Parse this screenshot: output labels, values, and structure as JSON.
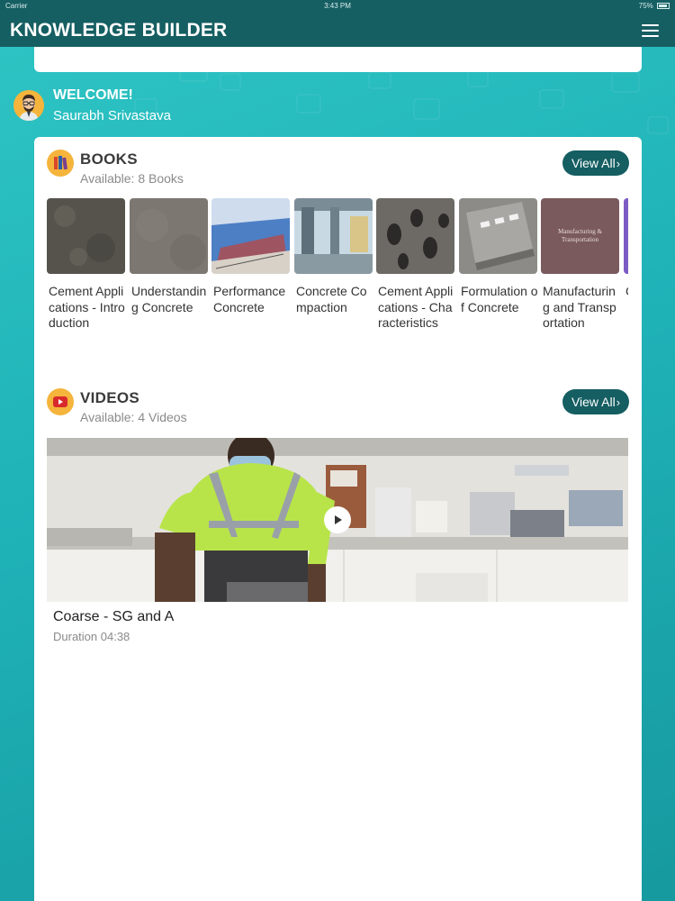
{
  "status_bar": {
    "carrier": "Carrier",
    "time": "3:43 PM",
    "battery": "75%"
  },
  "header": {
    "title": "KNOWLEDGE BUILDER",
    "menu_icon": "hamburger-menu-icon"
  },
  "welcome": {
    "title": "WELCOME!",
    "name": "Saurabh Srivastava"
  },
  "books": {
    "title": "BOOKS",
    "subtitle": "Available: 8 Books",
    "view_all": "View All",
    "items": [
      {
        "title": "Cement Applications - Introduction",
        "cover_color": "#5d5a52"
      },
      {
        "title": "Understanding Concrete",
        "cover_color": "#7c7771"
      },
      {
        "title": "Performance Concrete",
        "cover_color": "#9bb3d4"
      },
      {
        "title": "Concrete Compaction",
        "cover_color": "#6b7c88"
      },
      {
        "title": "Cement Applications - Characteristics",
        "cover_color": "#55514d"
      },
      {
        "title": "Formulation of Concrete",
        "cover_color": "#8d8b88"
      },
      {
        "title": "Manufacturing and Transportation",
        "cover_color": "#7a5a5c",
        "cover_text": "Manufacturing & Transportation"
      },
      {
        "title": "C",
        "cover_color": "#7b5cc4"
      }
    ]
  },
  "videos": {
    "title": "VIDEOS",
    "subtitle": "Available: 4 Videos",
    "view_all": "View All",
    "items": [
      {
        "title": "Coarse - SG and A",
        "duration": "Duration 04:38"
      }
    ]
  },
  "colors": {
    "header": "#155e62",
    "accent": "#f5b43b",
    "background": "#1fb3b8"
  }
}
